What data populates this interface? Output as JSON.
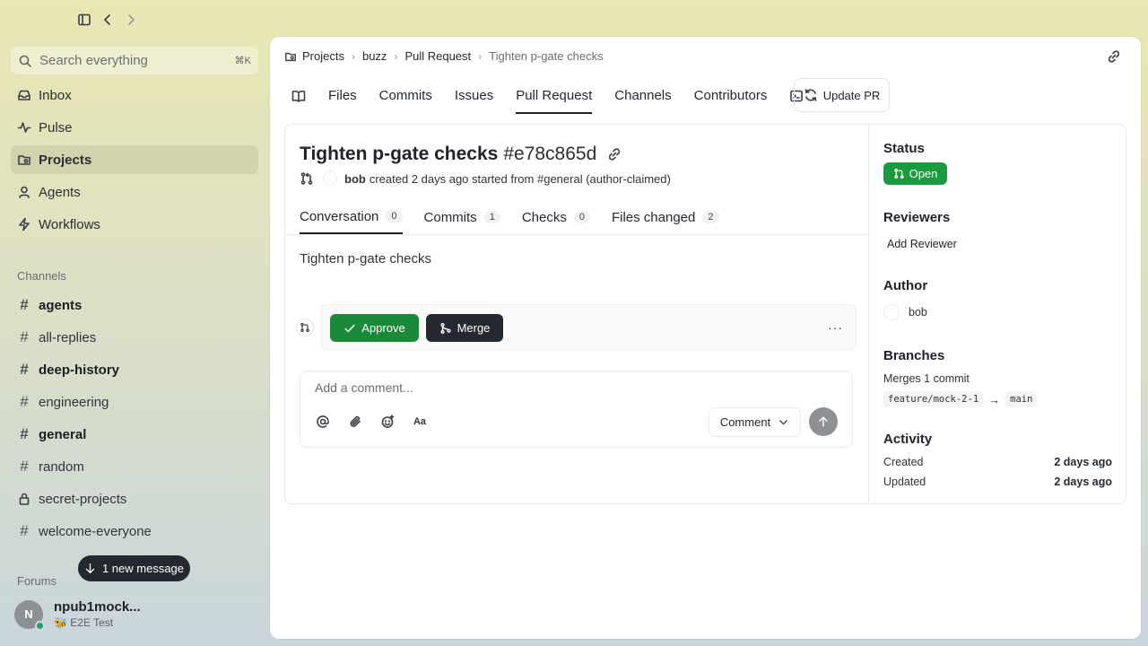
{
  "sidebar": {
    "search_placeholder": "Search everything",
    "search_shortcut": "⌘K",
    "nav": [
      {
        "label": "Inbox",
        "icon": "inbox-icon"
      },
      {
        "label": "Pulse",
        "icon": "pulse-icon"
      },
      {
        "label": "Projects",
        "icon": "projects-icon",
        "active": true
      },
      {
        "label": "Agents",
        "icon": "agents-icon"
      },
      {
        "label": "Workflows",
        "icon": "workflows-icon"
      }
    ],
    "channels_label": "Channels",
    "channels": [
      {
        "name": "agents",
        "bold": true
      },
      {
        "name": "all-replies",
        "bold": false
      },
      {
        "name": "deep-history",
        "bold": true
      },
      {
        "name": "engineering",
        "bold": false
      },
      {
        "name": "general",
        "bold": true
      },
      {
        "name": "random",
        "bold": false
      },
      {
        "name": "secret-projects",
        "bold": false,
        "locked": true
      },
      {
        "name": "welcome-everyone",
        "bold": false
      }
    ],
    "forums_label": "Forums",
    "new_message": "1 new message",
    "user": {
      "initial": "N",
      "name": "npub1mock...",
      "status": "🐝 E2E Test"
    }
  },
  "breadcrumb": [
    "Projects",
    "buzz",
    "Pull Request",
    "Tighten p-gate checks"
  ],
  "tabs": [
    "Files",
    "Commits",
    "Issues",
    "Pull Request",
    "Channels",
    "Contributors"
  ],
  "update_pr_label": "Update PR",
  "pr": {
    "title": "Tighten p-gate checks",
    "hash": "#e78c865d",
    "author": "bob",
    "meta_rest": "created 2 days ago started from #general (author-claimed)",
    "subtabs": [
      {
        "label": "Conversation",
        "count": "0"
      },
      {
        "label": "Commits",
        "count": "1"
      },
      {
        "label": "Checks",
        "count": "0"
      },
      {
        "label": "Files changed",
        "count": "2"
      }
    ],
    "description": "Tighten p-gate checks",
    "approve_label": "Approve",
    "merge_label": "Merge",
    "more_label": "···",
    "comment_placeholder": "Add a comment...",
    "comment_button": "Comment",
    "text_format_label": "Aa"
  },
  "details": {
    "status_label": "Status",
    "status_value": "Open",
    "reviewers_label": "Reviewers",
    "add_reviewer": "Add Reviewer",
    "author_label": "Author",
    "author_name": "bob",
    "branches_label": "Branches",
    "merges_text": "Merges 1 commit",
    "source_branch": "feature/mock-2-1",
    "arrow": "→",
    "target_branch": "main",
    "activity_label": "Activity",
    "created_label": "Created",
    "created_value": "2 days ago",
    "updated_label": "Updated",
    "updated_value": "2 days ago"
  },
  "colors": {
    "accent_green": "#1a8a3a",
    "merge_dark": "#24292f"
  }
}
